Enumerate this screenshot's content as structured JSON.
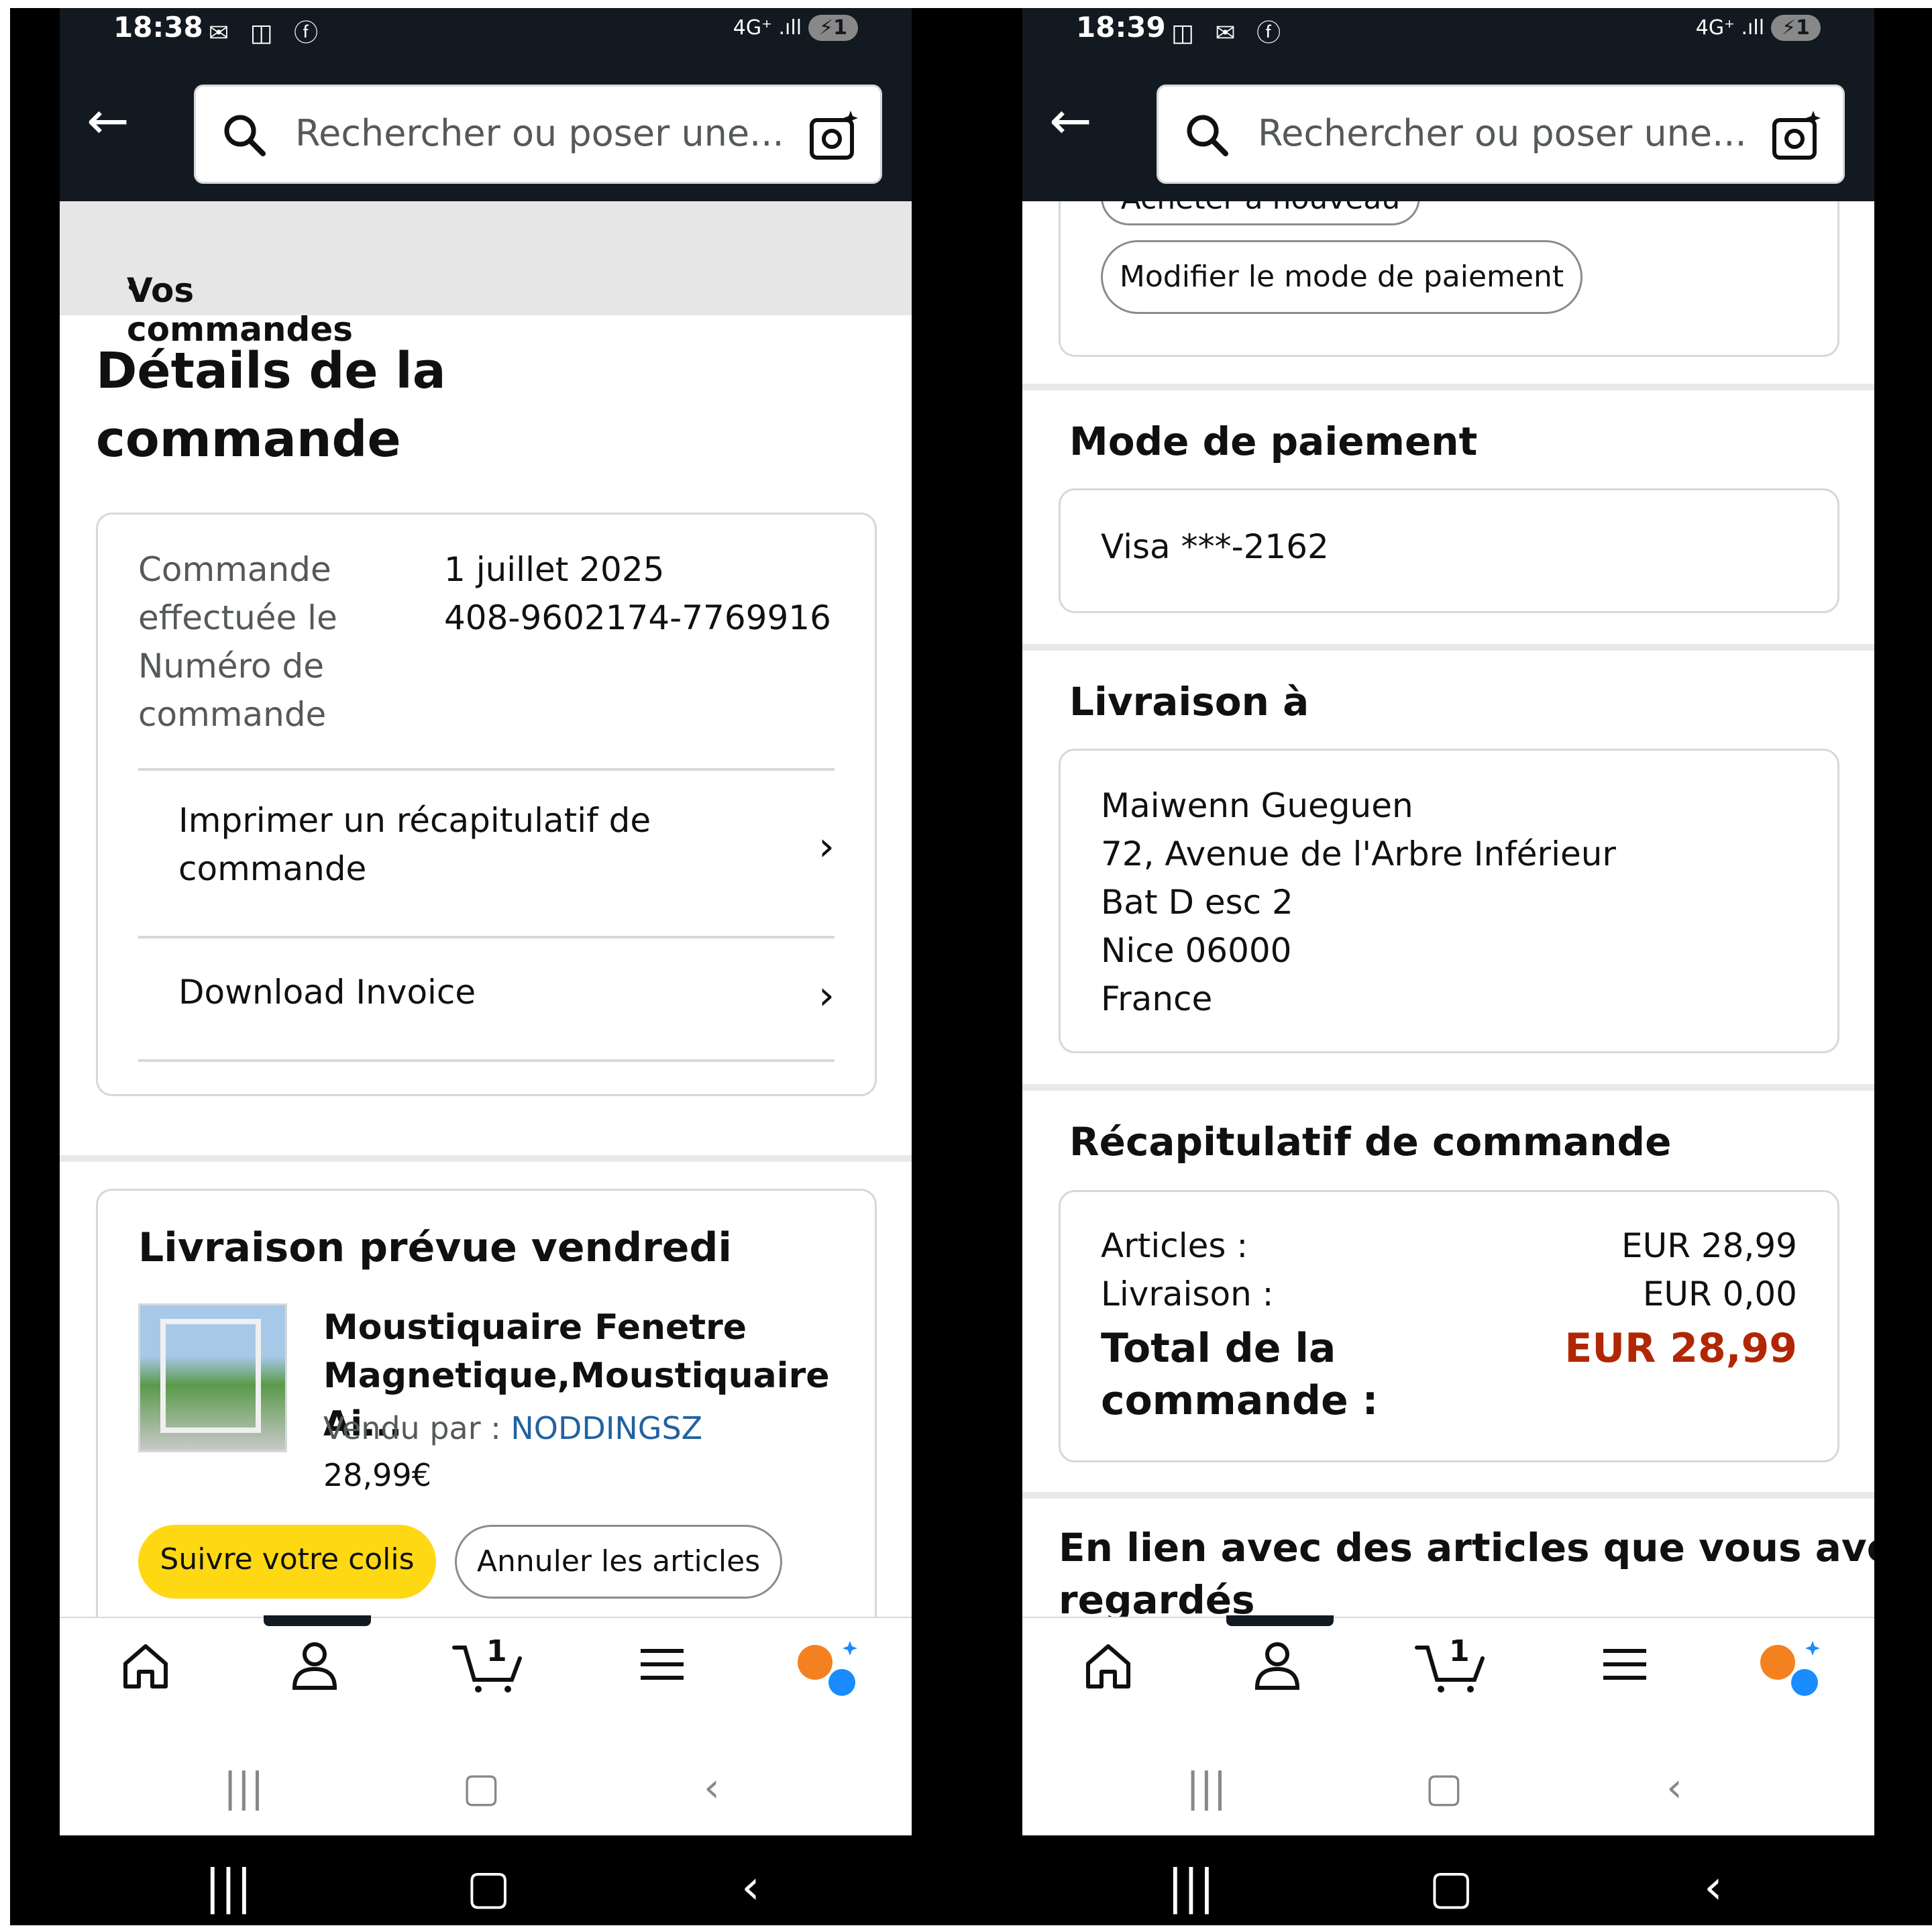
{
  "left": {
    "status": {
      "time": "18:38",
      "icons": "✉ ◫ ⓕ",
      "right": "4G⁺ .ıll",
      "battery": "⚡1"
    },
    "search": {
      "placeholder": "Rechercher ou poser une..."
    },
    "breadcrumb": "Vos commandes",
    "page_title_line1": "Détails de la",
    "page_title_line2": "commande",
    "order_info": {
      "placed_label_1": "Commande",
      "placed_label_2": "effectuée le",
      "number_label_1": "Numéro de",
      "number_label_2": "commande",
      "date": "1 juillet 2025",
      "number": "408-9602174-7769916"
    },
    "links": {
      "print_1": "Imprimer un récapitulatif de",
      "print_2": "commande",
      "invoice": "Download Invoice"
    },
    "delivery": {
      "heading": "Livraison prévue vendredi",
      "product_1": "Moustiquaire Fenetre",
      "product_2": "Magnetique,Moustiquaire Ai...",
      "sold_by": "Vendu par  :",
      "seller": "NODDINGSZ",
      "price": "28,99€",
      "track_button": "Suivre votre colis",
      "cancel_button": "Annuler les articles"
    },
    "cart_count": "1"
  },
  "right": {
    "status": {
      "time": "18:39",
      "icons": "◫ ✉ ⓕ",
      "right": "4G⁺ .ıll",
      "battery": "⚡1"
    },
    "search": {
      "placeholder": "Rechercher ou poser une..."
    },
    "partial_button": "Acheter à nouveau",
    "modify_payment_button": "Modifier le mode de paiement",
    "payment": {
      "heading": "Mode de paiement",
      "card": "Visa ***-2162"
    },
    "shipping": {
      "heading": "Livraison à",
      "name": "Maiwenn Gueguen",
      "street": "72, Avenue de l'Arbre Inférieur",
      "building": "Bat D esc 2",
      "city": "Nice 06000",
      "country": "France"
    },
    "summary": {
      "heading": "Récapitulatif de commande",
      "items_label": "Articles :",
      "items_value": "EUR 28,99",
      "shipping_label": "Livraison :",
      "shipping_value": "EUR 0,00",
      "total_label_1": "Total de la",
      "total_label_2": "commande :",
      "total_value": "EUR 28,99"
    },
    "related_1": "En lien avec des articles que vous avez",
    "related_2": "regardés",
    "cart_count": "1"
  },
  "colors": {
    "header": "#131921",
    "yellow": "#ffd814",
    "price_red": "#b12704",
    "link": "#2162a1"
  }
}
